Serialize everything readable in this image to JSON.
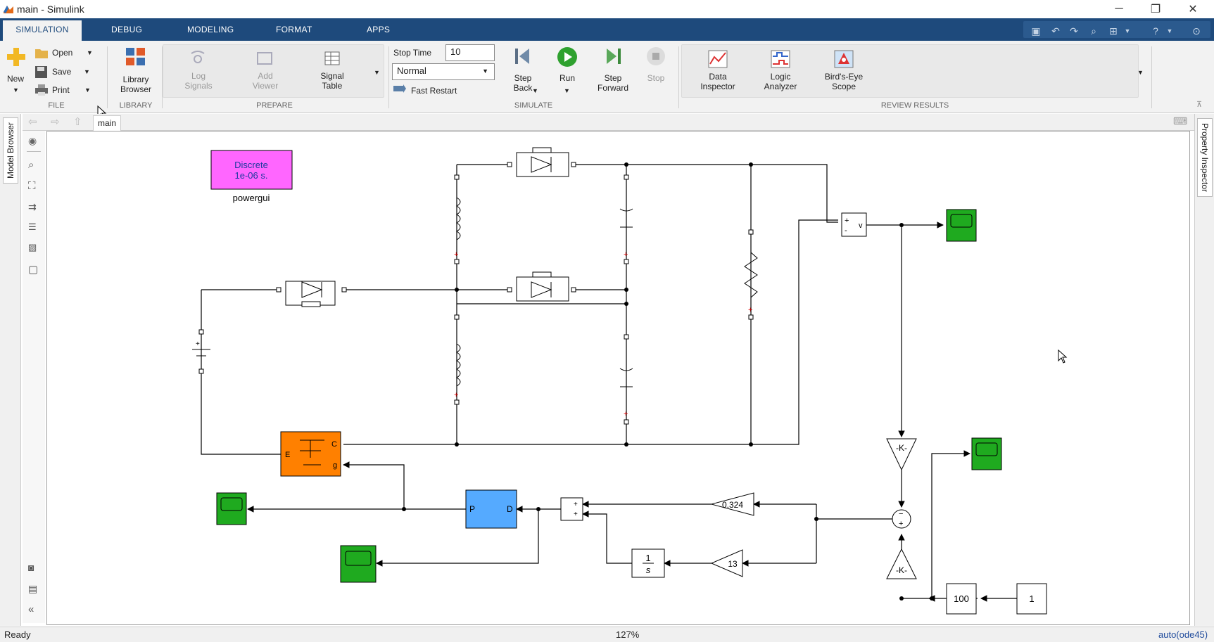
{
  "window": {
    "title": "main - Simulink"
  },
  "tabs": [
    "SIMULATION",
    "DEBUG",
    "MODELING",
    "FORMAT",
    "APPS"
  ],
  "file": {
    "new": "New",
    "open": "Open",
    "save": "Save",
    "print": "Print",
    "section": "FILE"
  },
  "library": {
    "browser": "Library Browser",
    "section": "LIBRARY"
  },
  "prepare": {
    "log_signals": "Log Signals",
    "add_viewer": "Add Viewer",
    "signal_table": "Signal Table",
    "section": "PREPARE"
  },
  "simulate": {
    "stop_time_label": "Stop Time",
    "stop_time_value": "10",
    "mode": "Normal",
    "fast_restart": "Fast Restart",
    "step_back": "Step Back",
    "run": "Run",
    "step_forward": "Step Forward",
    "stop": "Stop",
    "section": "SIMULATE"
  },
  "review": {
    "data_inspector": "Data Inspector",
    "logic_analyzer": "Logic Analyzer",
    "birds_eye": "Bird's-Eye Scope",
    "section": "REVIEW RESULTS"
  },
  "breadcrumb": {
    "model": "main"
  },
  "side_tabs": {
    "left": "Model Browser",
    "right": "Property Inspector"
  },
  "diagram": {
    "powergui_line1": "Discrete",
    "powergui_line2": "1e-06 s.",
    "powergui_label": "powergui",
    "gain_kp": "0.324",
    "gain_ki": "13",
    "gain_k": "-K-",
    "const_100": "100",
    "const_1": "1",
    "pid_p": "P",
    "pid_d": "D",
    "igbt_e": "E",
    "igbt_c": "C",
    "igbt_g": "g",
    "vm_v": "v",
    "integrator_num": "1",
    "integrator_den": "s"
  },
  "status": {
    "left": "Ready",
    "zoom": "127%",
    "solver": "auto(ode45)"
  },
  "colors": {
    "accent": "#1e4a7c",
    "scope": "#1faa1f",
    "powergui": "#ff66ff",
    "igbt": "#ff8000",
    "pid": "#55aaff"
  }
}
